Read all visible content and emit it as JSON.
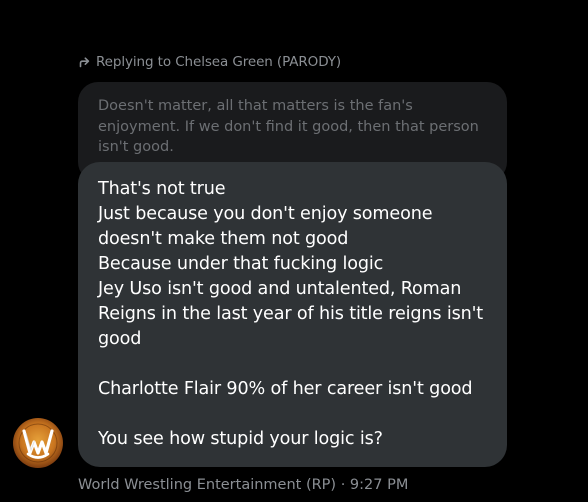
{
  "reply": {
    "text": "Replying to Chelsea Green (PARODY)",
    "icon": "reply-arrow-icon"
  },
  "quoted": {
    "lines": [
      "Doesn't matter, all that matters is the fan's",
      "enjoyment. If we don't find it good, then that person",
      "isn't good."
    ]
  },
  "message": {
    "lines": [
      "That's not true",
      "Just because you don't enjoy someone",
      "doesn't make them not good",
      "Because under that fucking logic",
      "Jey Uso isn't good and untalented, Roman",
      "Reigns in the last year of his title reigns isn't",
      "good",
      "",
      "Charlotte Flair 90% of her career isn't good",
      "",
      "You see how stupid your logic is?"
    ]
  },
  "sender": {
    "name": "World Wrestling Entertainment (RP)",
    "separator": "·",
    "time": "9:27 PM",
    "avatar_icon": "wwe-logo-icon"
  },
  "colors": {
    "background": "#000000",
    "bubble": "#2f3336",
    "quoted_bubble": "#1a1b1d",
    "muted_text": "#8b8f94"
  }
}
